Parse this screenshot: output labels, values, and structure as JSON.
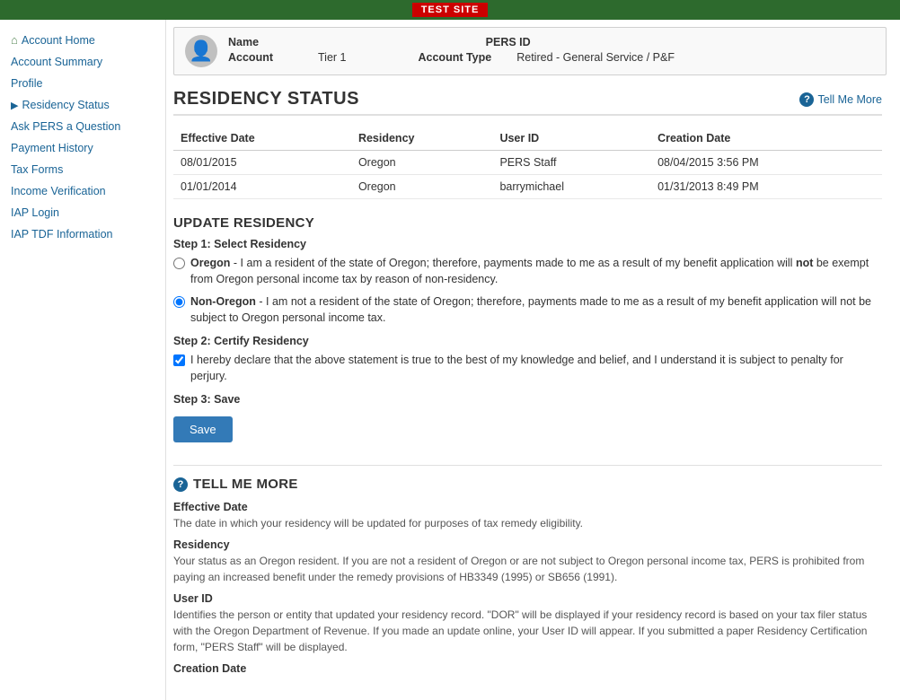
{
  "topBar": {
    "badge": "TEST SITE"
  },
  "sidebar": {
    "items": [
      {
        "label": "Account Home",
        "icon": "home",
        "active": false
      },
      {
        "label": "Account Summary",
        "icon": null,
        "active": false
      },
      {
        "label": "Profile",
        "icon": null,
        "active": false
      },
      {
        "label": "Residency Status",
        "icon": null,
        "active": true,
        "chevron": true
      },
      {
        "label": "Ask PERS a Question",
        "icon": null,
        "active": false
      },
      {
        "label": "Payment History",
        "icon": null,
        "active": false
      },
      {
        "label": "Tax Forms",
        "icon": null,
        "active": false
      },
      {
        "label": "Income Verification",
        "icon": null,
        "active": false
      },
      {
        "label": "IAP Login",
        "icon": null,
        "active": false
      },
      {
        "label": "IAP TDF Information",
        "icon": null,
        "active": false
      }
    ]
  },
  "accountBox": {
    "nameLabel": "Name",
    "persIdLabel": "PERS ID",
    "accountLabel": "Account",
    "accountValue": "Tier 1",
    "accountTypeLabel": "Account Type",
    "accountTypeValue": "Retired - General Service / P&F"
  },
  "pageTitle": "RESIDENCY STATUS",
  "tellMeMoreLink": "Tell Me More",
  "table": {
    "headers": [
      "Effective Date",
      "Residency",
      "User ID",
      "Creation Date"
    ],
    "rows": [
      {
        "effectiveDate": "08/01/2015",
        "residency": "Oregon",
        "userId": "PERS Staff",
        "creationDate": "08/04/2015 3:56 PM"
      },
      {
        "effectiveDate": "01/01/2014",
        "residency": "Oregon",
        "userId": "barrymichael",
        "creationDate": "01/31/2013 8:49 PM"
      }
    ]
  },
  "updateSection": {
    "title": "UPDATE RESIDENCY",
    "step1Label": "Step 1: Select Residency",
    "oregonOption": {
      "label": "Oregon",
      "text": " - I am a resident of the state of Oregon; therefore, payments made to me as a result of my benefit application will ",
      "boldText": "not",
      "textAfter": " be exempt from Oregon personal income tax by reason of non-residency."
    },
    "nonOregonOption": {
      "label": "Non-Oregon",
      "text": " - I am not a resident of the state of Oregon; therefore, payments made to me as a result of my benefit application will not be subject to Oregon personal income tax."
    },
    "step2Label": "Step 2: Certify Residency",
    "certifyText": "I hereby declare that the above statement is true to the best of my knowledge and belief, and I understand it is subject to penalty for perjury.",
    "step3Label": "Step 3: ",
    "step3Bold": "Save",
    "saveButton": "Save"
  },
  "tellMeMore": {
    "title": "TELL ME MORE",
    "items": [
      {
        "title": "Effective Date",
        "text": "The date in which your residency will be updated for purposes of tax remedy eligibility."
      },
      {
        "title": "Residency",
        "text": "Your status as an Oregon resident. If you are not a resident of Oregon or are not subject to Oregon personal income tax, PERS is prohibited from paying an increased benefit under the remedy provisions of HB3349 (1995) or SB656 (1991)."
      },
      {
        "title": "User ID",
        "text": "Identifies the person or entity that updated your residency record. \"DOR\" will be displayed if your residency record is based on your tax filer status with the Oregon Department of Revenue. If you made an update online, your User ID will appear. If you submitted a paper Residency Certification form, \"PERS Staff\" will be displayed."
      },
      {
        "title": "Creation Date",
        "text": ""
      }
    ]
  }
}
